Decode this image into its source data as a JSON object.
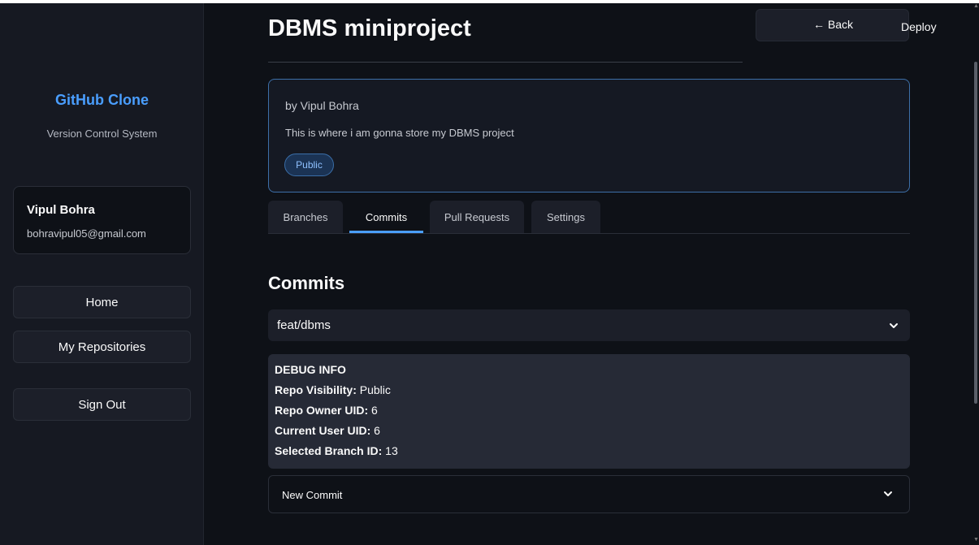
{
  "sidebar": {
    "title": "GitHub Clone",
    "subtitle": "Version Control System",
    "user": {
      "name": "Vipul Bohra",
      "email": "bohravipul05@gmail.com"
    },
    "nav": {
      "home": "Home",
      "repos": "My Repositories",
      "signout": "Sign Out"
    }
  },
  "header": {
    "title": "DBMS miniproject",
    "back_label": "← Back",
    "deploy_label": "Deploy"
  },
  "repo": {
    "by": "by Vipul Bohra",
    "description": "This is where i am gonna store my DBMS project",
    "visibility": "Public"
  },
  "tabs": [
    {
      "label": "Branches"
    },
    {
      "label": "Commits"
    },
    {
      "label": "Pull Requests"
    },
    {
      "label": "Settings"
    }
  ],
  "section_title": "Commits",
  "branch_select": {
    "value": "feat/dbms"
  },
  "debug": {
    "heading": "DEBUG INFO",
    "visibility_label": "Repo Visibility:",
    "visibility_value": "Public",
    "owner_label": "Repo Owner UID:",
    "owner_value": "6",
    "current_label": "Current User UID:",
    "current_value": "6",
    "branch_label": "Selected Branch ID:",
    "branch_value": "13"
  },
  "new_commit": {
    "label": "New Commit"
  },
  "colors": {
    "accent": "#4a9eff",
    "background": "#0e1117",
    "sidebar": "#161922",
    "card_border": "#3d6fa8"
  }
}
